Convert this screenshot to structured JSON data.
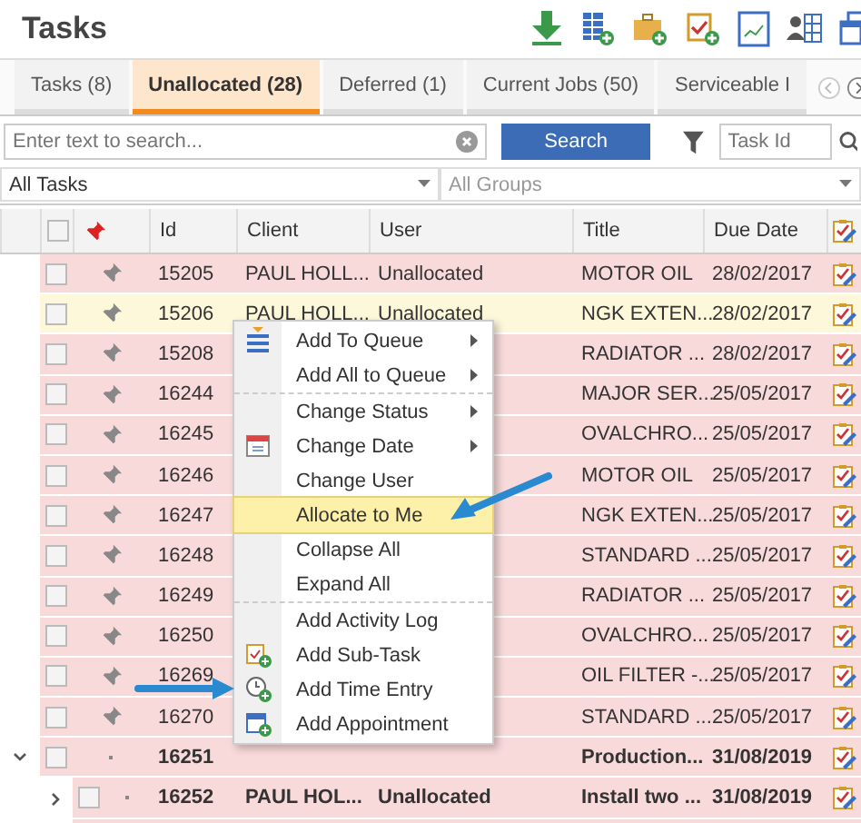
{
  "header": {
    "title": "Tasks"
  },
  "tabs": [
    {
      "label": "Tasks (8)",
      "selected": false
    },
    {
      "label": "Unallocated (28)",
      "selected": true
    },
    {
      "label": "Deferred (1)",
      "selected": false
    },
    {
      "label": "Current Jobs (50)",
      "selected": false
    },
    {
      "label": "Serviceable I",
      "selected": false
    }
  ],
  "search": {
    "placeholder": "Enter text to search...",
    "button": "Search",
    "task_id_placeholder": "Task Id"
  },
  "filters": [
    {
      "value": "All Tasks",
      "disabled": false
    },
    {
      "value": "All Groups",
      "disabled": true
    }
  ],
  "table": {
    "select_all_checked": false,
    "columns": [
      "Id",
      "Client",
      "User",
      "Title",
      "Due Date"
    ],
    "rows": [
      {
        "kind": "task",
        "id": "15205",
        "client": "PAUL HOLL...",
        "user": "Unallocated",
        "title": "MOTOR OIL",
        "due_date": "28/02/2017",
        "selected": false,
        "checked": false
      },
      {
        "kind": "task",
        "id": "15206",
        "client": "PAUL HOLL...",
        "user": "Unallocated",
        "title": "NGK EXTEN...",
        "due_date": "28/02/2017",
        "selected": true,
        "checked": false
      },
      {
        "kind": "task",
        "id": "15208",
        "title": "RADIATOR ...",
        "due_date": "28/02/2017",
        "selected": false,
        "checked": false
      },
      {
        "kind": "task",
        "id": "16244",
        "title": "MAJOR SER...",
        "due_date": "25/05/2017",
        "selected": false,
        "checked": false
      },
      {
        "kind": "task",
        "id": "16245",
        "title": "OVALCHRO...",
        "due_date": "25/05/2017",
        "selected": false,
        "checked": false
      },
      {
        "kind": "task",
        "id": "16246",
        "title": "MOTOR OIL",
        "due_date": "25/05/2017",
        "selected": false,
        "checked": false
      },
      {
        "kind": "task",
        "id": "16247",
        "title": "NGK EXTEN...",
        "due_date": "25/05/2017",
        "selected": false,
        "checked": false
      },
      {
        "kind": "task",
        "id": "16248",
        "title": "STANDARD ...",
        "due_date": "25/05/2017",
        "selected": false,
        "checked": false
      },
      {
        "kind": "task",
        "id": "16249",
        "title": "RADIATOR ...",
        "due_date": "25/05/2017",
        "selected": false,
        "checked": false
      },
      {
        "kind": "task",
        "id": "16250",
        "title": "OVALCHRO...",
        "due_date": "25/05/2017",
        "selected": false,
        "checked": false
      },
      {
        "kind": "task",
        "id": "16269",
        "title": "OIL FILTER -...",
        "due_date": "25/05/2017",
        "selected": false,
        "checked": false
      },
      {
        "kind": "task",
        "id": "16270",
        "title": "STANDARD ...",
        "due_date": "25/05/2017",
        "selected": false,
        "checked": false
      },
      {
        "kind": "group",
        "id": "16251",
        "title": "Production...",
        "due_date": "31/08/2019",
        "selected": false,
        "checked": false,
        "expanded": true,
        "children": [
          {
            "kind": "group",
            "id": "16252",
            "client": "PAUL HOL...",
            "user": "Unallocated",
            "title": "Install two ...",
            "due_date": "31/08/2019",
            "selected": false,
            "checked": false,
            "expanded": false
          }
        ]
      }
    ]
  },
  "context_menu": {
    "sections": [
      [
        {
          "label": "Add To Queue",
          "kind": "submenu",
          "selected": false
        },
        {
          "label": "Add All to Queue",
          "kind": "submenu",
          "selected": false
        }
      ],
      [
        {
          "label": "Change Status",
          "kind": "submenu",
          "selected": false
        },
        {
          "label": "Change Date",
          "kind": "submenu",
          "selected": false
        },
        {
          "label": "Change User",
          "kind": "action",
          "selected": false
        },
        {
          "label": "Allocate to Me",
          "kind": "action",
          "selected": true
        },
        {
          "label": "Collapse All",
          "kind": "action",
          "selected": false
        },
        {
          "label": "Expand All",
          "kind": "action",
          "selected": false
        }
      ],
      [
        {
          "label": "Add Activity Log",
          "kind": "action",
          "selected": false
        },
        {
          "label": "Add Sub-Task",
          "kind": "action",
          "selected": false
        },
        {
          "label": "Add Time Entry",
          "kind": "action",
          "selected": false
        },
        {
          "label": "Add Appointment",
          "kind": "action",
          "selected": false
        }
      ]
    ]
  }
}
